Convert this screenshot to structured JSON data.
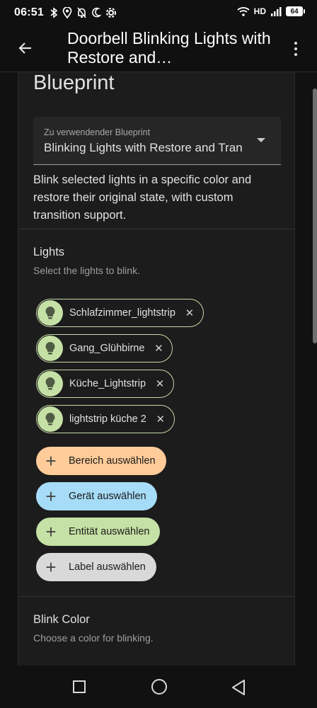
{
  "status_bar": {
    "time": "06:51",
    "network": "HD",
    "battery": "64"
  },
  "app_bar": {
    "title": "Doorbell Blinking Lights with Restore and…"
  },
  "blueprint": {
    "heading": "Blueprint",
    "select_label": "Zu verwendender Blueprint",
    "select_value": "Blinking Lights with Restore and Transition",
    "description": "Blink selected lights in a specific color and restore their original state, with custom transition support."
  },
  "lights": {
    "title": "Lights",
    "subtitle": "Select the lights to blink.",
    "chips": [
      {
        "label": "Schlafzimmer_lightstrip"
      },
      {
        "label": "Gang_Glühbirne"
      },
      {
        "label": "Küche_Lightstrip"
      },
      {
        "label": "lightstrip küche 2"
      }
    ],
    "add_buttons": [
      {
        "label": "Bereich auswählen",
        "color": "#ffcc99"
      },
      {
        "label": "Gerät auswählen",
        "color": "#a6dcf7"
      },
      {
        "label": "Entität auswählen",
        "color": "#c5e1a5"
      },
      {
        "label": "Label auswählen",
        "color": "#d9d9d9"
      }
    ]
  },
  "blink_color": {
    "title": "Blink Color",
    "subtitle": "Choose a color for blinking."
  },
  "colors": {
    "chip_avatar": "#c5e1a5",
    "chip_border": "#c5d9a8",
    "card_background": "#1c1c1c"
  }
}
